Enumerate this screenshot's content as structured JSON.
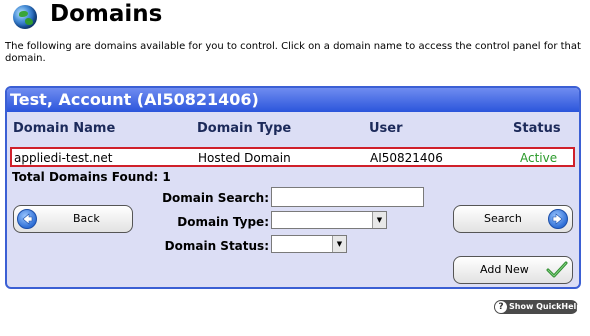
{
  "header": {
    "title": "Domains",
    "intro": "The following are domains available for you to control. Click on a domain name to access the control panel for that domain."
  },
  "panel": {
    "title": "Test, Account (AI50821406)",
    "columns": [
      "Domain Name",
      "Domain Type",
      "User",
      "Status"
    ],
    "rows": [
      {
        "domain_name": "appliedi-test.net",
        "domain_type": "Hosted Domain",
        "user": "AI50821406",
        "status": "Active"
      }
    ],
    "total_label": "Total Domains Found: 1"
  },
  "filters": {
    "search_label": "Domain Search:",
    "search_value": "",
    "type_label": "Domain Type:",
    "type_value": "",
    "status_label": "Domain Status:",
    "status_value": ""
  },
  "buttons": {
    "back": "Back",
    "search": "Search",
    "add_new": "Add New"
  },
  "quickhelp": {
    "label": "Show QuickHelp",
    "icon": "?"
  },
  "colors": {
    "panel_border": "#3b5fd4",
    "panel_bg": "#dcdef5",
    "row_highlight": "#d0202a",
    "status_active": "#2a9a2a"
  },
  "icons": [
    "globe-icon",
    "back-arrow-icon",
    "search-arrow-icon",
    "checkmark-icon",
    "help-icon"
  ]
}
